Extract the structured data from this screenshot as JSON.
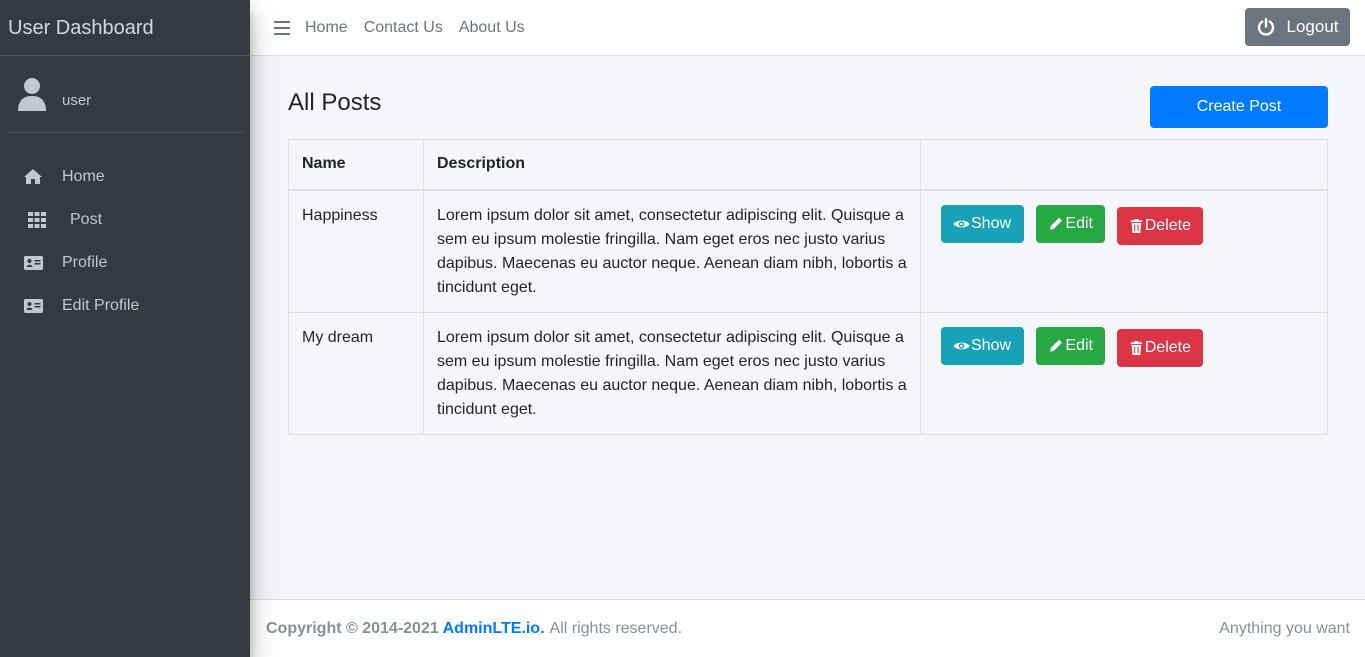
{
  "sidebar": {
    "brand": "User Dashboard",
    "user_name": "user",
    "items": [
      {
        "label": "Home",
        "icon": "home-icon"
      },
      {
        "label": "Post",
        "icon": "grid-icon"
      },
      {
        "label": "Profile",
        "icon": "id-card-icon"
      },
      {
        "label": "Edit Profile",
        "icon": "id-card-icon"
      }
    ]
  },
  "topnav": {
    "links": [
      "Home",
      "Contact Us",
      "About Us"
    ],
    "logout_label": "Logout"
  },
  "main": {
    "title": "All Posts",
    "create_label": "Create Post",
    "table": {
      "headers": [
        "Name",
        "Description",
        ""
      ],
      "rows": [
        {
          "name": "Happiness",
          "description": "Lorem ipsum dolor sit amet, consectetur adipiscing elit. Quisque a sem eu ipsum molestie fringilla. Nam eget eros nec justo varius dapibus. Maecenas eu auctor neque. Aenean diam nibh, lobortis a tincidunt eget."
        },
        {
          "name": "My dream",
          "description": "Lorem ipsum dolor sit amet, consectetur adipiscing elit. Quisque a sem eu ipsum molestie fringilla. Nam eget eros nec justo varius dapibus. Maecenas eu auctor neque. Aenean diam nibh, lobortis a tincidunt eget."
        }
      ],
      "actions": {
        "show": "Show",
        "edit": "Edit",
        "delete": "Delete"
      }
    }
  },
  "footer": {
    "copyright": "Copyright © 2014-2021",
    "link": "AdminLTE.io.",
    "rights": "All rights reserved.",
    "right_text": "Anything you want"
  },
  "colors": {
    "sidebar_bg": "#343a40",
    "primary": "#007bff",
    "info": "#17a2b8",
    "success": "#28a745",
    "danger": "#dc3545",
    "secondary": "#6c757d"
  }
}
